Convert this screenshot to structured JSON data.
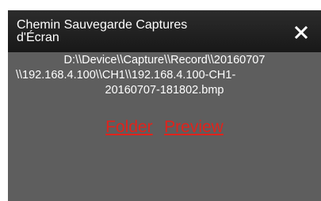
{
  "dialog": {
    "title_line1": "Chemin Sauvegarde Captures",
    "title_line2": "d'Écran",
    "close_icon": "close-icon"
  },
  "path": {
    "line1": "D:\\\\Device\\\\Capture\\\\Record\\\\20160707",
    "line2": "\\\\192.168.4.100\\\\CH1\\\\192.168.4.100-CH1-",
    "line3": "20160707-181802.bmp"
  },
  "links": {
    "folder": "Folder",
    "preview": "Preview"
  },
  "colors": {
    "background": "#5e5e5e",
    "titlebar": "#1f1f1f",
    "link": "#e0231c",
    "text": "#ffffff"
  }
}
